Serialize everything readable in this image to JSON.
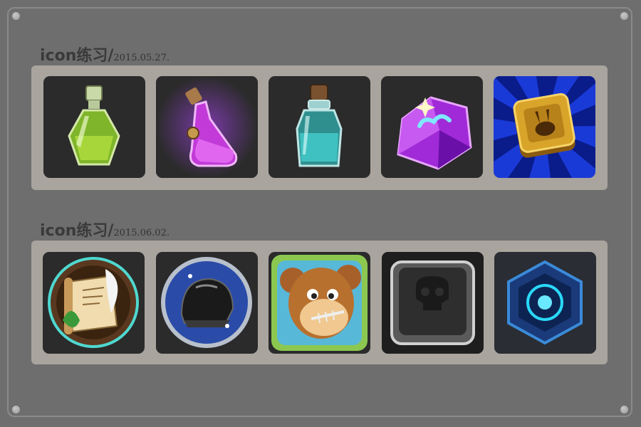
{
  "sections": [
    {
      "title": "icon练习/",
      "date": "2015.05.27.",
      "icons": [
        {
          "name": "green-potion-bottle"
        },
        {
          "name": "purple-potion-flask"
        },
        {
          "name": "teal-potion-bottle"
        },
        {
          "name": "purple-crystal"
        },
        {
          "name": "gold-rabbit-block"
        }
      ]
    },
    {
      "title": "icon练习/",
      "date": "2015.06.02.",
      "icons": [
        {
          "name": "scroll-quill-badge"
        },
        {
          "name": "black-helmet-badge"
        },
        {
          "name": "monkey-fishbone-app"
        },
        {
          "name": "metal-skull-button"
        },
        {
          "name": "blue-hexagon-gem"
        }
      ]
    }
  ],
  "colors": {
    "background": "#6e6e6e",
    "panel": "#a9a59e",
    "tile": "#2b2b2b",
    "title": "#3a3a3a"
  }
}
